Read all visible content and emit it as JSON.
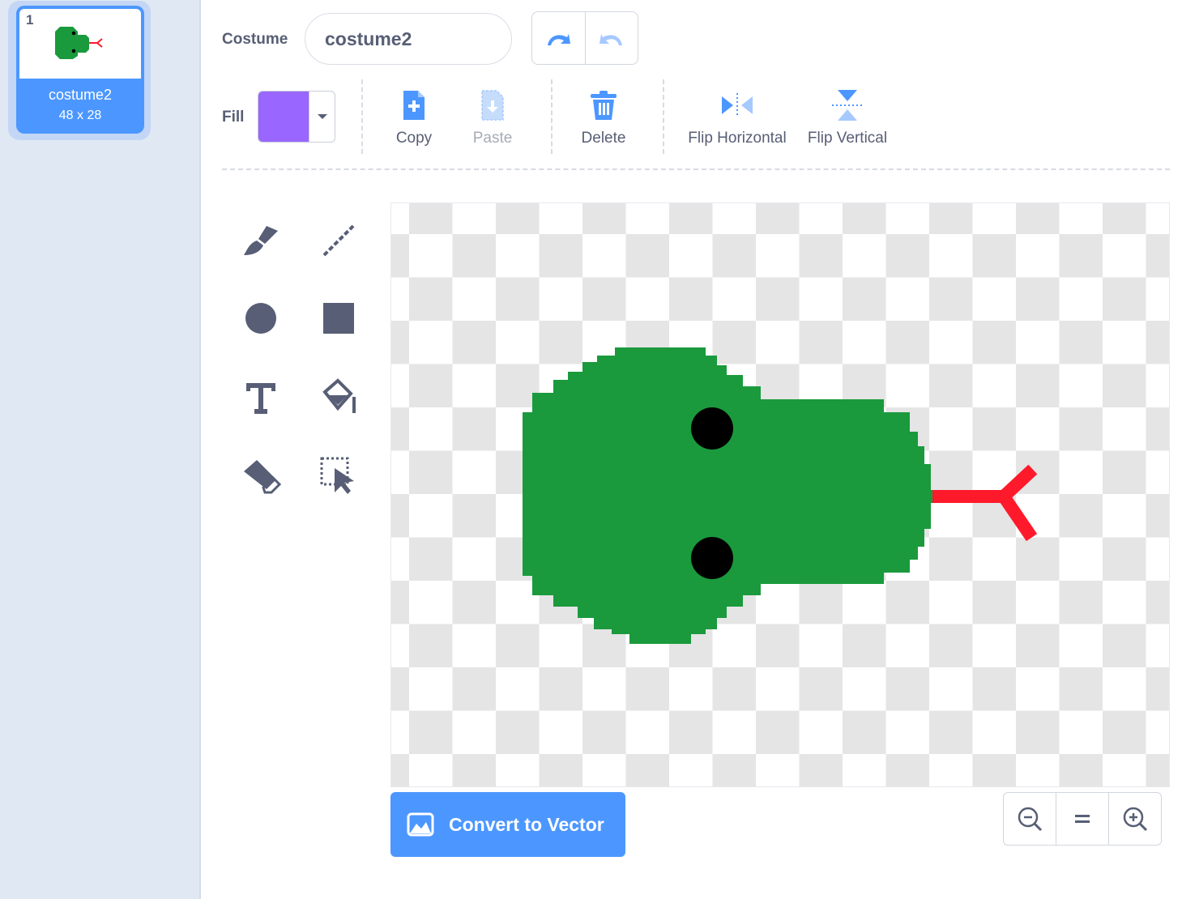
{
  "costume_list": {
    "items": [
      {
        "index": "1",
        "name": "costume2",
        "size": "48 x 28"
      }
    ]
  },
  "costume_field": {
    "label": "Costume",
    "value": "costume2"
  },
  "fill": {
    "label": "Fill",
    "color": "#9966ff"
  },
  "toolbar": {
    "copy_label": "Copy",
    "paste_label": "Paste",
    "delete_label": "Delete",
    "flip_horizontal_label": "Flip Horizontal",
    "flip_vertical_label": "Flip Vertical"
  },
  "palette": [
    "brush",
    "line",
    "circle",
    "rectangle",
    "text",
    "fill",
    "eraser",
    "select"
  ],
  "canvas": {
    "costume_colors": {
      "body": "#1a9a3c",
      "eyes": "#000000",
      "tongue": "#ff1a2b"
    }
  },
  "convert_button": {
    "label": "Convert to Vector"
  },
  "zoom": {
    "out_icon": "zoom-out-icon",
    "reset_icon": "zoom-reset-icon",
    "in_icon": "zoom-in-icon"
  }
}
